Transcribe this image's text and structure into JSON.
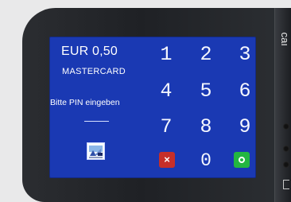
{
  "screen": {
    "amount": "EUR 0,50",
    "card": "MASTERCARD",
    "prompt": "Bitte PIN eingeben"
  },
  "keypad": {
    "keys": [
      "1",
      "2",
      "3",
      "4",
      "5",
      "6",
      "7",
      "8",
      "9",
      "0"
    ],
    "cancel_symbol": "×",
    "ok_symbol": "○"
  },
  "device": {
    "side_text": "ıɐɔ"
  },
  "colors": {
    "screen": "#1a39b3",
    "cancel": "#c62f2a",
    "ok": "#23b641",
    "bezel": "#1f2125"
  },
  "icons": {
    "card_reader": "card-reader-icon",
    "cancel": "cancel-icon",
    "confirm": "confirm-icon"
  }
}
